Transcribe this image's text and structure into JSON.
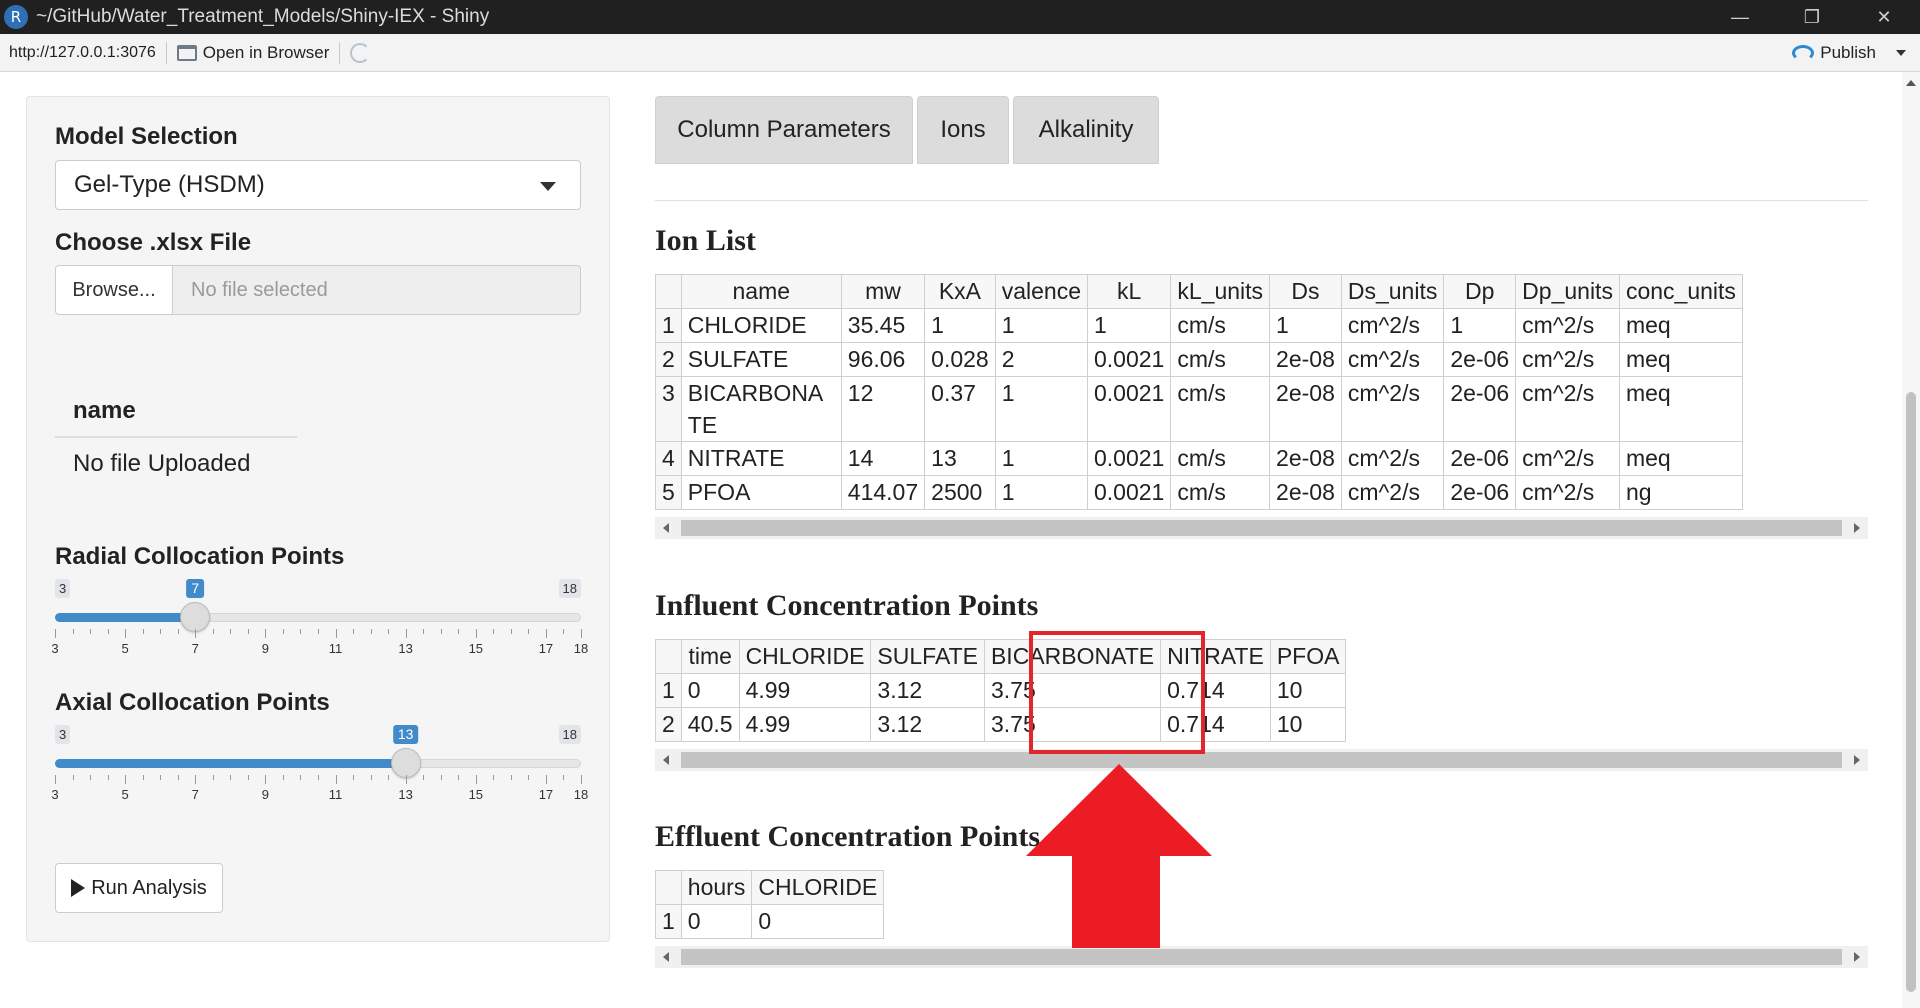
{
  "window": {
    "app_badge": "R",
    "title": "~/GitHub/Water_Treatment_Models/Shiny-IEX - Shiny",
    "minimize": "—",
    "restore": "❐",
    "close": "✕"
  },
  "toolbar": {
    "url": "http://127.0.0.1:3076",
    "open_in_browser": "Open in Browser",
    "publish": "Publish"
  },
  "sidebar": {
    "model_selection_label": "Model Selection",
    "model_selected": "Gel-Type (HSDM)",
    "choose_file_label": "Choose .xlsx File",
    "browse_label": "Browse...",
    "file_placeholder": "No file selected",
    "name_header": "name",
    "name_value": "No file Uploaded",
    "radial": {
      "label": "Radial Collocation Points",
      "min": "3",
      "max": "18",
      "value": "7",
      "min_num": 3,
      "max_num": 18,
      "value_num": 7,
      "tick_labels": [
        "3",
        "5",
        "7",
        "9",
        "11",
        "13",
        "15",
        "17",
        "18"
      ]
    },
    "axial": {
      "label": "Axial Collocation Points",
      "min": "3",
      "max": "18",
      "value": "13",
      "min_num": 3,
      "max_num": 18,
      "value_num": 13,
      "tick_labels": [
        "3",
        "5",
        "7",
        "9",
        "11",
        "13",
        "15",
        "17",
        "18"
      ]
    },
    "run_label": "Run Analysis"
  },
  "tabs": [
    {
      "label": "Column Parameters"
    },
    {
      "label": "Ions"
    },
    {
      "label": "Alkalinity"
    }
  ],
  "ion_list": {
    "title": "Ion List",
    "headers": [
      "",
      "name",
      "mw",
      "KxA",
      "valence",
      "kL",
      "kL_units",
      "Ds",
      "Ds_units",
      "Dp",
      "Dp_units",
      "conc_units"
    ],
    "rows": [
      [
        "1",
        "CHLORIDE",
        "35.45",
        "1",
        "1",
        "1",
        "cm/s",
        "1",
        "cm^2/s",
        "1",
        "cm^2/s",
        "meq"
      ],
      [
        "2",
        "SULFATE",
        "96.06",
        "0.028",
        "2",
        "0.0021",
        "cm/s",
        "2e-08",
        "cm^2/s",
        "2e-06",
        "cm^2/s",
        "meq"
      ],
      [
        "3",
        "BICARBONATE",
        "12",
        "0.37",
        "1",
        "0.0021",
        "cm/s",
        "2e-08",
        "cm^2/s",
        "2e-06",
        "cm^2/s",
        "meq"
      ],
      [
        "4",
        "NITRATE",
        "14",
        "13",
        "1",
        "0.0021",
        "cm/s",
        "2e-08",
        "cm^2/s",
        "2e-06",
        "cm^2/s",
        "meq"
      ],
      [
        "5",
        "PFOA",
        "414.07",
        "2500",
        "1",
        "0.0021",
        "cm/s",
        "2e-08",
        "cm^2/s",
        "2e-06",
        "cm^2/s",
        "ng"
      ]
    ]
  },
  "influent": {
    "title": "Influent Concentration Points",
    "headers": [
      "",
      "time",
      "CHLORIDE",
      "SULFATE",
      "BICARBONATE",
      "NITRATE",
      "PFOA"
    ],
    "rows": [
      [
        "1",
        "0",
        "4.99",
        "3.12",
        "3.75",
        "0.714",
        "10"
      ],
      [
        "2",
        "40.5",
        "4.99",
        "3.12",
        "3.75",
        "0.714",
        "10"
      ]
    ]
  },
  "effluent": {
    "title": "Effluent Concentration Points",
    "headers": [
      "",
      "hours",
      "CHLORIDE"
    ],
    "rows": [
      [
        "1",
        "0",
        "0"
      ]
    ]
  },
  "colors": {
    "accent": "#428bca",
    "highlight": "#e4262b",
    "titlebar": "#202020"
  }
}
